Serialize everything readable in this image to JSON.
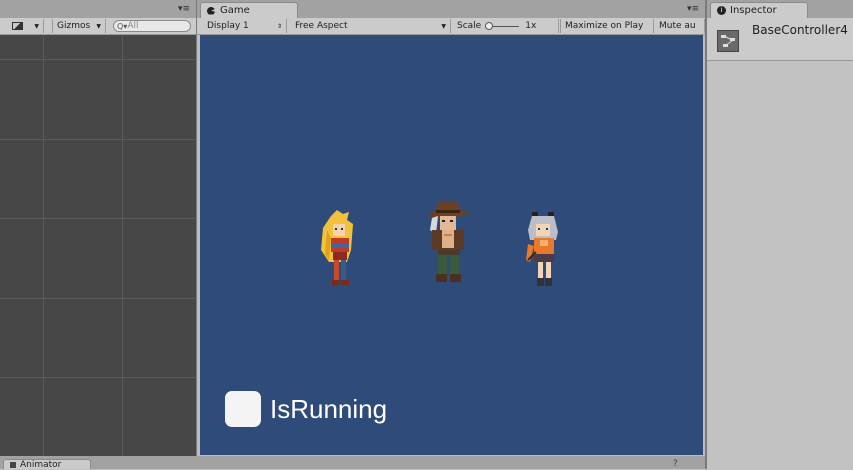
{
  "scene_panel": {
    "gizmos_label": "Gizmos",
    "search_placeholder": "All",
    "search_prefix": "Q▾"
  },
  "game_panel": {
    "tab_label": "Game",
    "display": "Display 1",
    "aspect": "Free Aspect",
    "scale_label": "Scale",
    "scale_value": "1x",
    "maximize_on_play": "Maximize on Play",
    "mute_audio": "Mute au",
    "toggle_label": "IsRunning",
    "background_color": "#2f4b7a"
  },
  "inspector_panel": {
    "tab_label": "Inspector",
    "object_name": "BaseController4"
  },
  "bottom_panel": {
    "tab_label": "Animator",
    "right_glyph": "?"
  },
  "characters": [
    "blonde-girl-sprite",
    "cowboy-sprite",
    "silver-hair-girl-sprite"
  ]
}
